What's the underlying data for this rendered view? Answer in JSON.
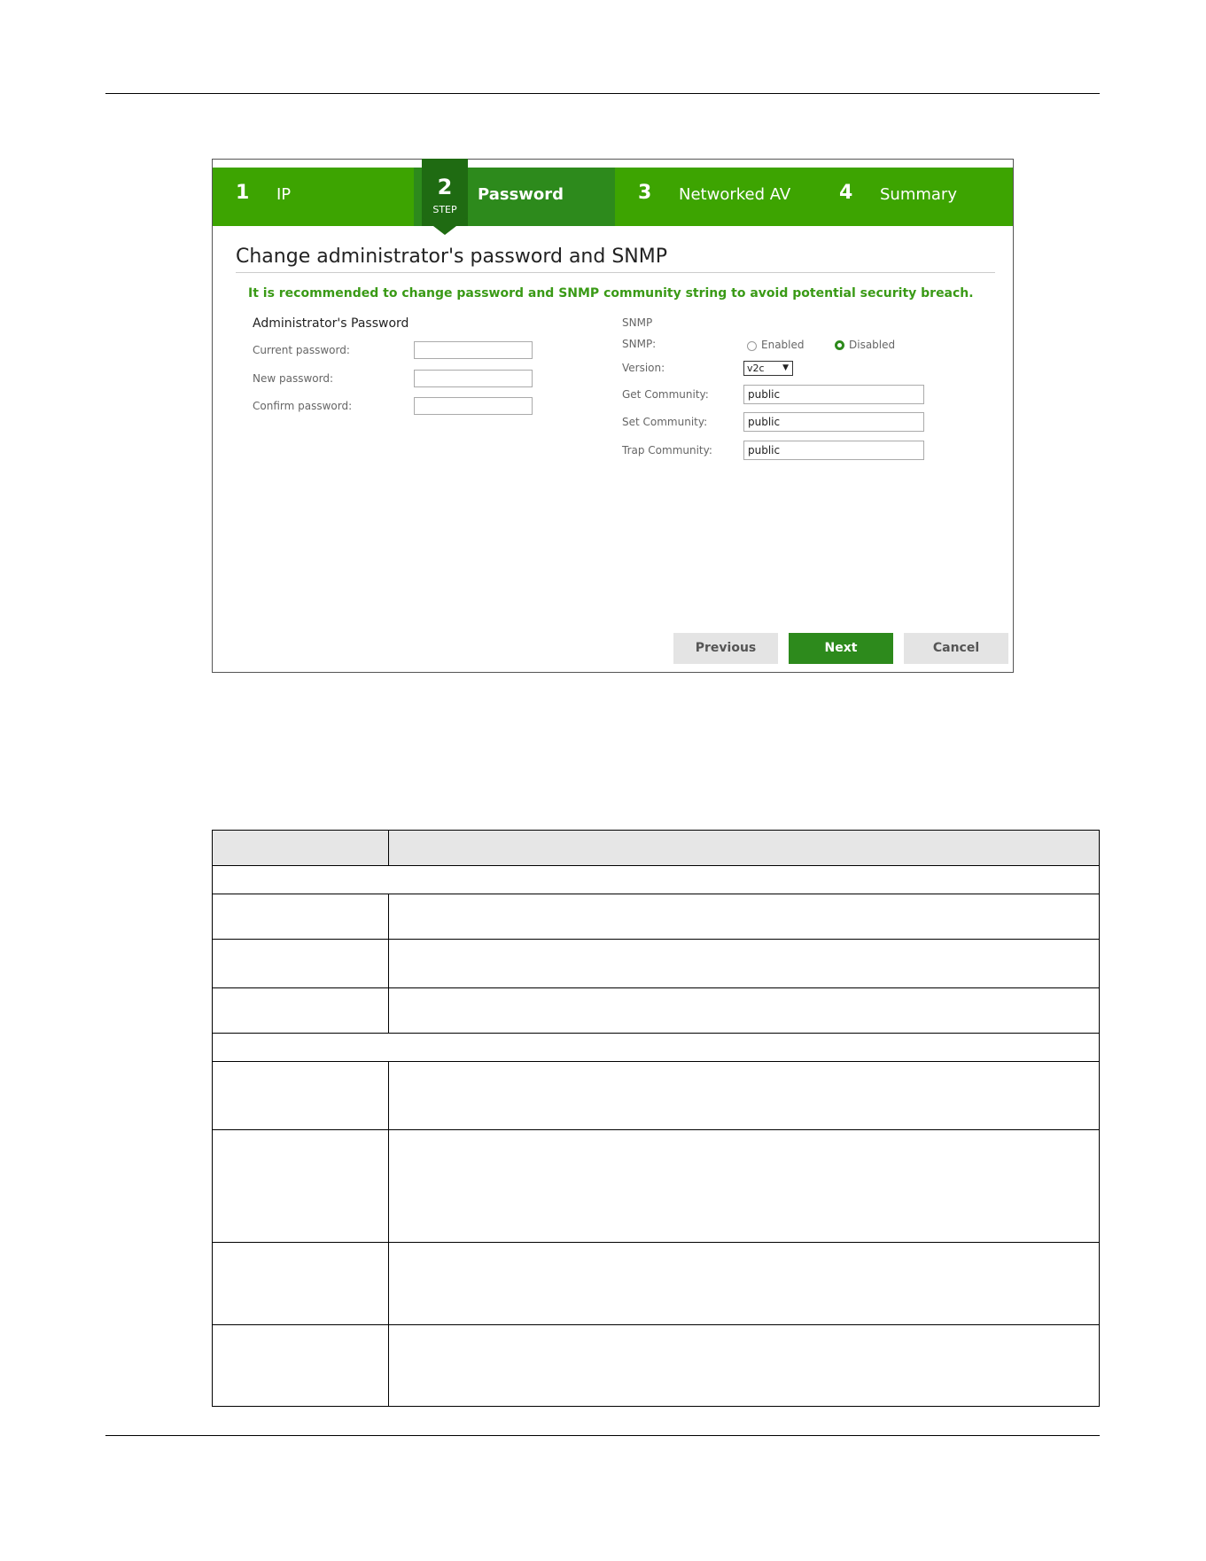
{
  "wizard": {
    "steps": [
      {
        "num": "1",
        "label": "IP"
      },
      {
        "num": "2",
        "label": "Password",
        "badge": "STEP"
      },
      {
        "num": "3",
        "label": "Networked AV"
      },
      {
        "num": "4",
        "label": "Summary"
      }
    ],
    "heading": "Change administrator's password and SNMP",
    "notice": "It is recommended to change password and SNMP community string to avoid potential security breach.",
    "admin": {
      "title": "Administrator's Password",
      "current_label": "Current password:",
      "new_label": "New password:",
      "confirm_label": "Confirm password:",
      "current_value": "",
      "new_value": "",
      "confirm_value": ""
    },
    "snmp": {
      "title": "SNMP",
      "snmp_label": "SNMP:",
      "enabled_label": "Enabled",
      "disabled_label": "Disabled",
      "selected": "Disabled",
      "version_label": "Version:",
      "version_value": "v2c",
      "get_label": "Get Community:",
      "get_value": "public",
      "set_label": "Set Community:",
      "set_value": "public",
      "trap_label": "Trap Community:",
      "trap_value": "public"
    },
    "buttons": {
      "previous": "Previous",
      "next": "Next",
      "cancel": "Cancel"
    },
    "colors": {
      "step_bar": "#3da401",
      "active_step": "#2d8a1c",
      "badge": "#1f6b12",
      "notice_text": "#3a9a16"
    }
  },
  "doc_table": {
    "header": [
      "",
      ""
    ],
    "rows": [
      {
        "type": "section",
        "cells": [
          ""
        ]
      },
      {
        "type": "row",
        "cells": [
          "",
          ""
        ]
      },
      {
        "type": "row",
        "cells": [
          "",
          ""
        ]
      },
      {
        "type": "row",
        "cells": [
          "",
          ""
        ]
      },
      {
        "type": "section",
        "cells": [
          ""
        ]
      },
      {
        "type": "row",
        "cells": [
          "",
          ""
        ]
      },
      {
        "type": "row",
        "cells": [
          "",
          ""
        ]
      },
      {
        "type": "row",
        "cells": [
          "",
          ""
        ]
      },
      {
        "type": "row",
        "cells": [
          "",
          ""
        ]
      }
    ]
  }
}
